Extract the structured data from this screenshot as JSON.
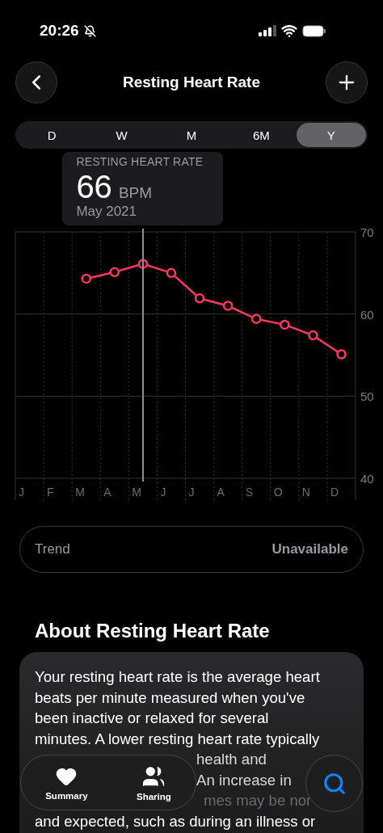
{
  "status_bar": {
    "time": "20:26"
  },
  "nav": {
    "title": "Resting Heart Rate"
  },
  "ranges": [
    {
      "label": "D",
      "selected": false
    },
    {
      "label": "W",
      "selected": false
    },
    {
      "label": "M",
      "selected": false
    },
    {
      "label": "6M",
      "selected": false
    },
    {
      "label": "Y",
      "selected": true
    }
  ],
  "tooltip": {
    "label": "RESTING HEART RATE",
    "value": "66",
    "unit": "BPM",
    "date": "May 2021"
  },
  "chart": {
    "chart_data": {
      "type": "line",
      "categories": [
        "J",
        "F",
        "M",
        "A",
        "M",
        "J",
        "J",
        "A",
        "S",
        "O",
        "N",
        "D"
      ],
      "series": [
        {
          "color": "#ff375f",
          "marker": "o",
          "values": [
            null,
            null,
            64.3,
            65.1,
            66.1,
            65,
            61.9,
            61,
            59.4,
            58.7,
            57.4,
            55.1
          ]
        }
      ],
      "ylim": [
        40,
        70
      ],
      "yticks": [
        40,
        50,
        60,
        70
      ],
      "ref_lines": [
        {
          "axis": "x",
          "value": "M"
        }
      ]
    }
  },
  "trend": {
    "label": "Trend",
    "value": "Unavailable"
  },
  "about": {
    "heading": "About Resting Heart Rate",
    "lines": [
      {
        "kind": "full",
        "text": "Your resting heart rate is the average heart"
      },
      {
        "kind": "full",
        "text": "beats per minute measured when you've"
      },
      {
        "kind": "full",
        "text": "been inactive or relaxed for several"
      },
      {
        "kind": "full",
        "text": "minutes. A lower resting heart rate typically"
      },
      {
        "kind": "partial",
        "text": "health and"
      },
      {
        "kind": "partial",
        "text": "An increase in"
      },
      {
        "kind": "faded",
        "text": "mes may be nor"
      },
      {
        "kind": "full",
        "text": "and expected, such as during an illness or"
      }
    ]
  },
  "tab_bar": {
    "tabs": [
      {
        "label": "Summary",
        "kind": "heart"
      },
      {
        "label": "Sharing",
        "kind": "people"
      }
    ]
  }
}
